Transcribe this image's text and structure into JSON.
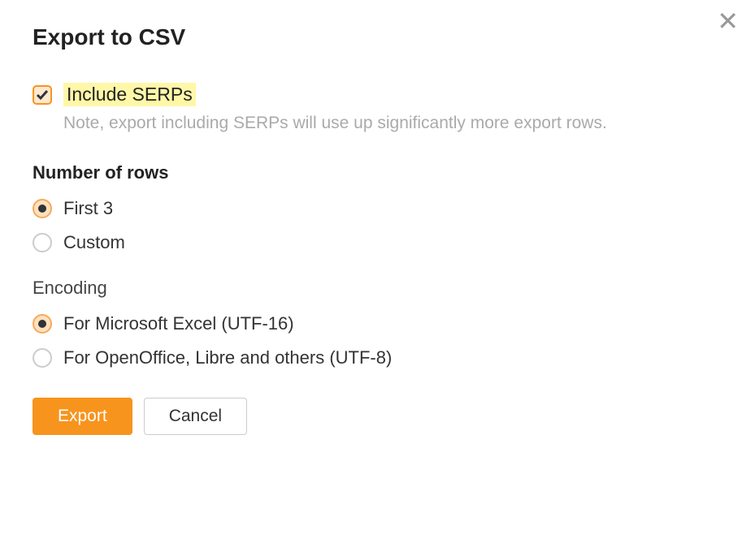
{
  "dialog": {
    "title": "Export to CSV",
    "include_serps": {
      "label": "Include SERPs",
      "checked": true,
      "note": "Note, export including SERPs will use up significantly more export rows."
    },
    "rows": {
      "label": "Number of rows",
      "options": [
        {
          "label": "First 3",
          "selected": true
        },
        {
          "label": "Custom",
          "selected": false
        }
      ]
    },
    "encoding": {
      "label": "Encoding",
      "options": [
        {
          "label": "For Microsoft Excel (UTF-16)",
          "selected": true
        },
        {
          "label": "For OpenOffice, Libre and others (UTF-8)",
          "selected": false
        }
      ]
    },
    "buttons": {
      "export": "Export",
      "cancel": "Cancel"
    }
  }
}
